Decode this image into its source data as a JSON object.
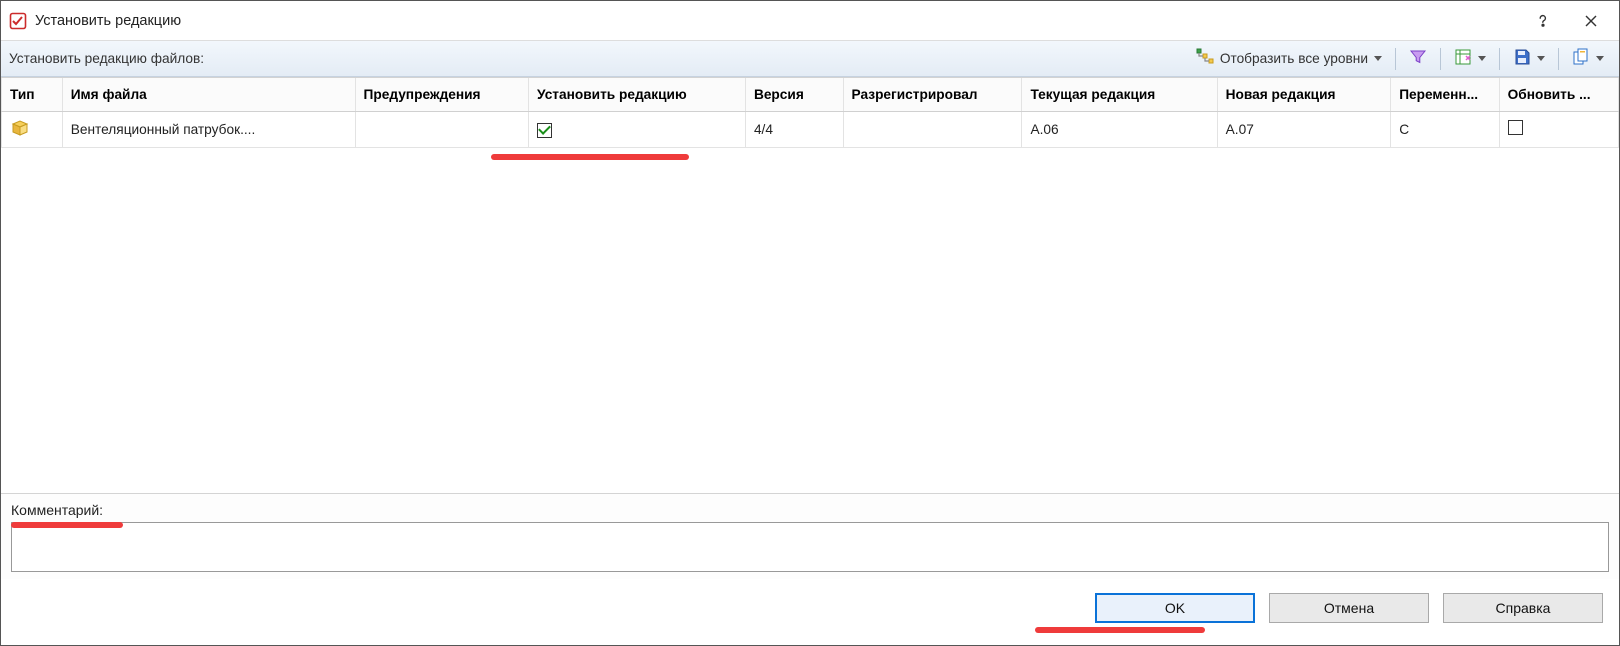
{
  "title": "Установить редакцию",
  "toolbar": {
    "label": "Установить редакцию файлов:",
    "show_all_levels": "Отобразить все уровни"
  },
  "columns": {
    "type": "Тип",
    "name": "Имя файла",
    "warnings": "Предупреждения",
    "set_revision": "Установить редакцию",
    "version": "Версия",
    "registered": "Разрегистрировал",
    "current_rev": "Текущая редакция",
    "new_rev": "Новая редакция",
    "variable": "Переменн...",
    "update": "Обновить ..."
  },
  "rows": [
    {
      "name": "Вентеляционный патрубок....",
      "warnings": "",
      "set_revision_checked": true,
      "version": "4/4",
      "registered": "",
      "current_rev": "A.06",
      "new_rev": "A.07",
      "variable": "C",
      "update_checked": false
    }
  ],
  "comment": {
    "label": "Комментарий:",
    "value": ""
  },
  "buttons": {
    "ok": "OK",
    "cancel": "Отмена",
    "help": "Справка"
  }
}
